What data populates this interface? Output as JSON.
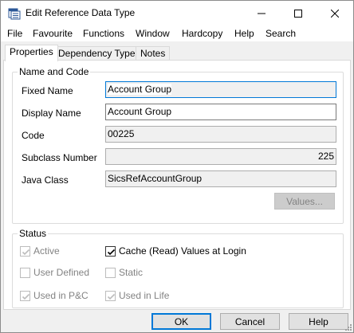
{
  "window": {
    "title": "Edit Reference Data Type",
    "controls": {
      "minimize": "minimize",
      "maximize": "maximize",
      "close": "close"
    }
  },
  "menu": [
    "File",
    "Favourite",
    "Functions",
    "Window",
    "Hardcopy",
    "Help",
    "Search"
  ],
  "tabs": [
    "Properties",
    "Dependency Types",
    "Notes"
  ],
  "active_tab": "Properties",
  "name_and_code": {
    "group_label": "Name and Code",
    "fixed_name_label": "Fixed Name",
    "fixed_name_value": "Account Group",
    "display_name_label": "Display Name",
    "display_name_value": "Account Group",
    "code_label": "Code",
    "code_value": "00225",
    "subclass_number_label": "Subclass Number",
    "subclass_number_value": "225",
    "java_class_label": "Java Class",
    "java_class_value": "SicsRefAccountGroup",
    "values_button": "Values..."
  },
  "status": {
    "group_label": "Status",
    "checkboxes": [
      {
        "label": "Active",
        "checked": true,
        "enabled": false
      },
      {
        "label": "Cache (Read) Values at Login",
        "checked": true,
        "enabled": true
      },
      {
        "label": "User Defined",
        "checked": false,
        "enabled": false
      },
      {
        "label": "Static",
        "checked": false,
        "enabled": false
      },
      {
        "label": "Used in P&C",
        "checked": true,
        "enabled": false
      },
      {
        "label": "Used in Life",
        "checked": true,
        "enabled": false
      }
    ]
  },
  "buttons": {
    "ok": "OK",
    "cancel": "Cancel",
    "help": "Help"
  },
  "colors": {
    "focus_border": "#0078d7",
    "disabled_text": "#838383",
    "panel_bg": "#f0f0f0"
  }
}
